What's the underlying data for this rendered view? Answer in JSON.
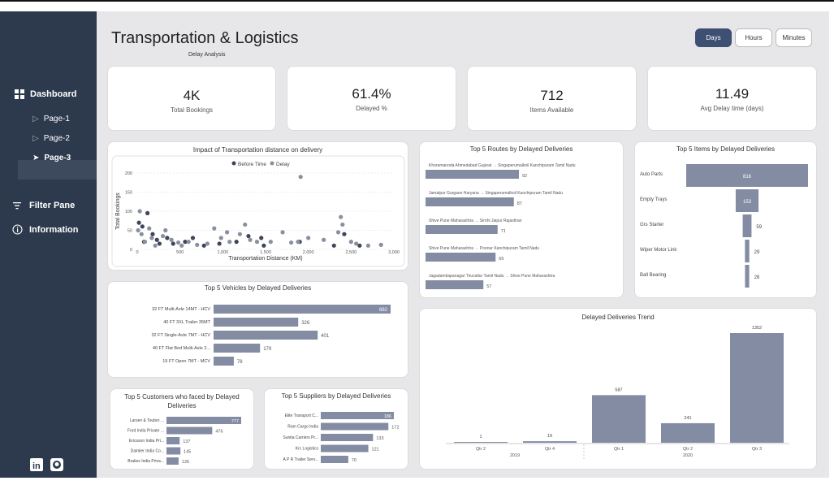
{
  "app": {
    "title": "Transportation & Logistics",
    "subtitle": "Delay Analysis"
  },
  "sidebar": {
    "dashboard_label": "Dashboard",
    "pages": [
      "Page-1",
      "Page-2",
      "Page-3"
    ],
    "active_page": "Page-3",
    "filter_label": "Filter Pane",
    "info_label": "Information"
  },
  "toggles": {
    "days": "Days",
    "hours": "Hours",
    "minutes": "Minutes",
    "active": "Days"
  },
  "kpis": [
    {
      "value": "4K",
      "label": "Total Bookings"
    },
    {
      "value": "61.4%",
      "label": "Delayed %"
    },
    {
      "value": "712",
      "label": "Items Available"
    },
    {
      "value": "11.49",
      "label": "Avg Delay time (days)"
    }
  ],
  "colors": {
    "bar": "#848ca3",
    "sidebar": "#2d3a4d",
    "dark_point": "#3e4559",
    "light_point": "#8a8fa0"
  },
  "scatter_card": {
    "title": "Impact of Transportation distance on delivery"
  },
  "routes_card": {
    "title": "Top 5 Routes by Delayed Deliveries"
  },
  "items_card": {
    "title": "Top 5 Items by Delayed Deliveries"
  },
  "vehicles_card": {
    "title": "Top 5 Vehicles by Delayed Deliveries"
  },
  "trend_card": {
    "title": "Delayed Deliveries Trend"
  },
  "customers_card": {
    "title": "Top 5 Customers who faced by Delayed Deliveries"
  },
  "suppliers_card": {
    "title": "Top 5 Suppliers by Delayed Deliveries"
  },
  "chart_data": [
    {
      "id": "scatter",
      "type": "scatter",
      "title": "Impact of Transportation distance on delivery",
      "xlabel": "Transportation Distance (KM)",
      "ylabel": "Total Bookings",
      "xlim": [
        0,
        3000
      ],
      "ylim": [
        0,
        200
      ],
      "xticks": [
        "0",
        "500",
        "1,000",
        "1,500",
        "2,000",
        "2,500",
        "3,000"
      ],
      "yticks": [
        "0",
        "50",
        "100",
        "150",
        "200"
      ],
      "legend": [
        "Before Time",
        "Delay"
      ],
      "series": [
        {
          "name": "Before Time",
          "points": [
            [
              20,
              70
            ],
            [
              60,
              60
            ],
            [
              80,
              20
            ],
            [
              120,
              95
            ],
            [
              180,
              40
            ],
            [
              230,
              25
            ],
            [
              260,
              15
            ],
            [
              350,
              30
            ],
            [
              420,
              15
            ],
            [
              560,
              20
            ],
            [
              650,
              30
            ],
            [
              780,
              10
            ],
            [
              960,
              15
            ],
            [
              1160,
              20
            ],
            [
              1300,
              35
            ],
            [
              1450,
              30
            ],
            [
              1480,
              10
            ],
            [
              1900,
              20
            ],
            [
              2300,
              10
            ],
            [
              2420,
              40
            ],
            [
              2600,
              10
            ]
          ]
        },
        {
          "name": "Delay",
          "points": [
            [
              10,
              50
            ],
            [
              30,
              100
            ],
            [
              50,
              40
            ],
            [
              90,
              20
            ],
            [
              140,
              55
            ],
            [
              170,
              30
            ],
            [
              210,
              10
            ],
            [
              300,
              35
            ],
            [
              330,
              50
            ],
            [
              400,
              25
            ],
            [
              480,
              18
            ],
            [
              520,
              10
            ],
            [
              600,
              20
            ],
            [
              700,
              12
            ],
            [
              820,
              15
            ],
            [
              900,
              55
            ],
            [
              980,
              30
            ],
            [
              1050,
              45
            ],
            [
              1080,
              20
            ],
            [
              1200,
              40
            ],
            [
              1260,
              65
            ],
            [
              1320,
              25
            ],
            [
              1400,
              20
            ],
            [
              1560,
              20
            ],
            [
              1700,
              45
            ],
            [
              1800,
              18
            ],
            [
              1880,
              20
            ],
            [
              1910,
              190
            ],
            [
              2000,
              30
            ],
            [
              2180,
              25
            ],
            [
              2350,
              45
            ],
            [
              2380,
              85
            ],
            [
              2400,
              65
            ],
            [
              2500,
              20
            ],
            [
              2560,
              15
            ],
            [
              2700,
              10
            ],
            [
              2850,
              12
            ]
          ]
        }
      ]
    },
    {
      "id": "routes",
      "type": "bar",
      "title": "Top 5 Routes by Delayed Deliveries",
      "categories": [
        "Khoramanoda Ahmedabad Gujarat → Singaperumalkoil Kanchipuram Tamil Nadu",
        "Jamalpur Gurgaon Haryana → Singaperumalkoil Kanchipuram Tamil Nadu",
        "Shive Pune Maharashtra → Sirohi Jaipur Rajasthan",
        "Shive Pune Maharashtra → Poonur Kanchipuram Tamil Nadu",
        "Jagadambapanagar Tiruvallur Tamil Nadu → Shive Pune Maharashtra"
      ],
      "values": [
        92,
        87,
        71,
        69,
        57
      ]
    },
    {
      "id": "items",
      "type": "bar",
      "title": "Top 5 Items by Delayed Deliveries",
      "categories": [
        "Auto Parts",
        "Empty Trays",
        "Grs Starter",
        "Wiper Motor Link",
        "Ball Bearing"
      ],
      "values": [
        816,
        153,
        59,
        29,
        28
      ]
    },
    {
      "id": "vehicles",
      "type": "bar",
      "title": "Top 5 Vehicles by Delayed Deliveries",
      "categories": [
        "32 FT Multi-Axle 14MT - HCV",
        "40 FT 3XL Trailer 35MT",
        "32 FT Single-Axle 7MT - HCV",
        "40 FT Flat Bed Multi-Axle 2...",
        "19 FT Open 7MT - MCV"
      ],
      "values": [
        682,
        326,
        401,
        179,
        78
      ]
    },
    {
      "id": "trend",
      "type": "bar",
      "title": "Delayed Deliveries Trend",
      "categories": [
        "Qtr 2",
        "Qtr 4",
        "Qtr 1",
        "Qtr 2",
        "Qtr 3"
      ],
      "groups": [
        "2019",
        "2020"
      ],
      "values": [
        1,
        19,
        587,
        241,
        1352
      ]
    },
    {
      "id": "customers",
      "type": "bar",
      "title": "Top 5 Customers who faced by Delayed Deliveries",
      "categories": [
        "Larsen & Toubro ...",
        "Ford India Private ...",
        "Ericsson India Pri...",
        "Daimler India Co...",
        "Brakes India Priva..."
      ],
      "values": [
        777,
        476,
        137,
        145,
        126
      ]
    },
    {
      "id": "suppliers",
      "type": "bar",
      "title": "Top 5 Suppliers by Delayed Deliveries",
      "categories": [
        "Elite Transport C...",
        "Ram Cargo India",
        "Sunita Carriers Pr...",
        "Krc Logistics",
        "A P R Trailer Serv..."
      ],
      "values": [
        186,
        172,
        133,
        121,
        70
      ]
    }
  ]
}
